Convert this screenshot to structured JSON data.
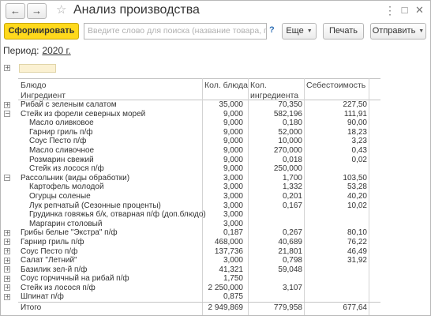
{
  "window": {
    "title": "Анализ производства"
  },
  "toolbar": {
    "generate_label": "Сформировать",
    "search_placeholder": "Введите слово для поиска (название товара, по...",
    "help_label": "?",
    "more_label": "Еще",
    "print_label": "Печать",
    "send_label": "Отправить"
  },
  "period": {
    "label": "Период:",
    "value": "2020 г."
  },
  "table": {
    "headers": {
      "dish": "Блюдо",
      "ingredient": "Ингредиент",
      "dish_qty": "Кол. блюда",
      "ingr_qty_1": "Кол.",
      "ingr_qty_2": "ингредиента",
      "cost": "Себестоимость"
    },
    "rows": [
      {
        "name": "Рибай с зеленым салатом",
        "level": 0,
        "expander": "+",
        "q1": "35,000",
        "q2": "70,350",
        "cost": "227,50"
      },
      {
        "name": "Стейк из форели северных морей",
        "level": 0,
        "expander": "−",
        "q1": "9,000",
        "q2": "582,196",
        "cost": "111,91"
      },
      {
        "name": "Масло оливковое",
        "level": 1,
        "expander": "",
        "q1": "9,000",
        "q2": "0,180",
        "cost": "90,00"
      },
      {
        "name": "Гарнир гриль п/ф",
        "level": 1,
        "expander": "",
        "q1": "9,000",
        "q2": "52,000",
        "cost": "18,23"
      },
      {
        "name": "Соус Песто п/ф",
        "level": 1,
        "expander": "",
        "q1": "9,000",
        "q2": "10,000",
        "cost": "3,23"
      },
      {
        "name": "Масло сливочное",
        "level": 1,
        "expander": "",
        "q1": "9,000",
        "q2": "270,000",
        "cost": "0,43"
      },
      {
        "name": "Розмарин свежий",
        "level": 1,
        "expander": "",
        "q1": "9,000",
        "q2": "0,018",
        "cost": "0,02"
      },
      {
        "name": "Стейк из лосося п/ф",
        "level": 1,
        "expander": "",
        "q1": "9,000",
        "q2": "250,000",
        "cost": ""
      },
      {
        "name": "Рассольник (виды обработки)",
        "level": 0,
        "expander": "−",
        "q1": "3,000",
        "q2": "1,700",
        "cost": "103,50"
      },
      {
        "name": "Картофель молодой",
        "level": 1,
        "expander": "",
        "q1": "3,000",
        "q2": "1,332",
        "cost": "53,28"
      },
      {
        "name": "Огурцы соленые",
        "level": 1,
        "expander": "",
        "q1": "3,000",
        "q2": "0,201",
        "cost": "40,20"
      },
      {
        "name": "Лук репчатый (Сезонные проценты)",
        "level": 1,
        "expander": "",
        "q1": "3,000",
        "q2": "0,167",
        "cost": "10,02"
      },
      {
        "name": "Грудинка говяжья б/к, отварная п/ф (доп.блюдо)",
        "level": 1,
        "expander": "",
        "q1": "3,000",
        "q2": "",
        "cost": ""
      },
      {
        "name": "Маргарин столовый",
        "level": 1,
        "expander": "",
        "q1": "3,000",
        "q2": "",
        "cost": ""
      },
      {
        "name": "Грибы белые \"Экстра\" п/ф",
        "level": 0,
        "expander": "+",
        "q1": "0,187",
        "q2": "0,267",
        "cost": "80,10"
      },
      {
        "name": "Гарнир гриль п/ф",
        "level": 0,
        "expander": "+",
        "q1": "468,000",
        "q2": "40,689",
        "cost": "76,22"
      },
      {
        "name": "Соус Песто п/ф",
        "level": 0,
        "expander": "+",
        "q1": "137,736",
        "q2": "21,801",
        "cost": "46,49"
      },
      {
        "name": "Салат \"Летний\"",
        "level": 0,
        "expander": "+",
        "q1": "3,000",
        "q2": "0,798",
        "cost": "31,92"
      },
      {
        "name": "Базилик зел-й п/ф",
        "level": 0,
        "expander": "+",
        "q1": "41,321",
        "q2": "59,048",
        "cost": ""
      },
      {
        "name": "Соус горчичный на рибай п/ф",
        "level": 0,
        "expander": "+",
        "q1": "1,750",
        "q2": "",
        "cost": ""
      },
      {
        "name": "Стейк из лосося п/ф",
        "level": 0,
        "expander": "+",
        "q1": "2 250,000",
        "q2": "3,107",
        "cost": ""
      },
      {
        "name": "Шпинат п/ф",
        "level": 0,
        "expander": "+",
        "q1": "0,875",
        "q2": "",
        "cost": ""
      }
    ],
    "total": {
      "label": "Итого",
      "q1": "2 949,869",
      "q2": "779,958",
      "cost": "677,64"
    }
  }
}
